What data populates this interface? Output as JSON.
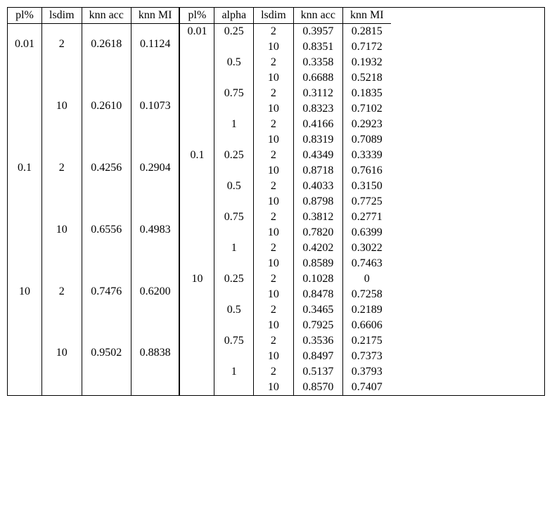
{
  "chart_data": {
    "type": "table",
    "title": "",
    "left_table": {
      "headers": [
        "pl%",
        "lsdim",
        "knn acc",
        "knn MI"
      ],
      "rows": [
        {
          "pl": "0.01",
          "lsdim": "2",
          "acc": "0.2618",
          "mi": "0.1124",
          "bold": true
        },
        {
          "pl": "",
          "lsdim": "",
          "acc": "",
          "mi": ""
        },
        {
          "pl": "",
          "lsdim": "",
          "acc": "",
          "mi": ""
        },
        {
          "pl": "",
          "lsdim": "",
          "acc": "",
          "mi": ""
        },
        {
          "pl": "",
          "lsdim": "10",
          "acc": "0.2610",
          "mi": "0.1073"
        },
        {
          "pl": "",
          "lsdim": "",
          "acc": "",
          "mi": ""
        },
        {
          "pl": "",
          "lsdim": "",
          "acc": "",
          "mi": ""
        },
        {
          "pl": "",
          "lsdim": "",
          "acc": "",
          "mi": ""
        },
        {
          "pl": "0.1",
          "lsdim": "2",
          "acc": "0.4256",
          "mi": "0.2904"
        },
        {
          "pl": "",
          "lsdim": "",
          "acc": "",
          "mi": ""
        },
        {
          "pl": "",
          "lsdim": "",
          "acc": "",
          "mi": ""
        },
        {
          "pl": "",
          "lsdim": "",
          "acc": "",
          "mi": ""
        },
        {
          "pl": "",
          "lsdim": "10",
          "acc": "0.6556",
          "mi": "0.4983",
          "bold": true
        },
        {
          "pl": "",
          "lsdim": "",
          "acc": "",
          "mi": ""
        },
        {
          "pl": "",
          "lsdim": "",
          "acc": "",
          "mi": ""
        },
        {
          "pl": "",
          "lsdim": "",
          "acc": "",
          "mi": ""
        },
        {
          "pl": "10",
          "lsdim": "2",
          "acc": "0.7476",
          "mi": "0.6200"
        },
        {
          "pl": "",
          "lsdim": "",
          "acc": "",
          "mi": ""
        },
        {
          "pl": "",
          "lsdim": "",
          "acc": "",
          "mi": ""
        },
        {
          "pl": "",
          "lsdim": "",
          "acc": "",
          "mi": ""
        },
        {
          "pl": "",
          "lsdim": "10",
          "acc": "0.9502",
          "mi": "0.8838",
          "bold": true
        },
        {
          "pl": "",
          "lsdim": "",
          "acc": "",
          "mi": ""
        },
        {
          "pl": "",
          "lsdim": "",
          "acc": "",
          "mi": ""
        },
        {
          "pl": "",
          "lsdim": "",
          "acc": "",
          "mi": ""
        }
      ]
    },
    "right_table": {
      "headers": [
        "pl%",
        "alpha",
        "lsdim",
        "knn acc",
        "knn MI"
      ],
      "rows": [
        {
          "pl": "0.01",
          "alpha": "0.25",
          "lsdim": "2",
          "acc": "0.3957",
          "mi": "0.2815"
        },
        {
          "pl": "",
          "alpha": "",
          "lsdim": "10",
          "acc": "0.8351",
          "mi": "0.7172",
          "bold": true
        },
        {
          "pl": "",
          "alpha": "0.5",
          "lsdim": "2",
          "acc": "0.3358",
          "mi": "0.1932"
        },
        {
          "pl": "",
          "alpha": "",
          "lsdim": "10",
          "acc": "0.6688",
          "mi": "0.5218"
        },
        {
          "pl": "",
          "alpha": "0.75",
          "lsdim": "2",
          "acc": "0.3112",
          "mi": "0.1835"
        },
        {
          "pl": "",
          "alpha": "",
          "lsdim": "10",
          "acc": "0.8323",
          "mi": "0.7102"
        },
        {
          "pl": "",
          "alpha": "1",
          "lsdim": "2",
          "acc": "0.4166",
          "mi": "0.2923"
        },
        {
          "pl": "",
          "alpha": "",
          "lsdim": "10",
          "acc": "0.8319",
          "mi": "0.7089"
        },
        {
          "pl": "0.1",
          "alpha": "0.25",
          "lsdim": "2",
          "acc": "0.4349",
          "mi": "0.3339"
        },
        {
          "pl": "",
          "alpha": "",
          "lsdim": "10",
          "acc": "0.8718",
          "mi": "0.7616"
        },
        {
          "pl": "",
          "alpha": "0.5",
          "lsdim": "2",
          "acc": "0.4033",
          "mi": "0.3150"
        },
        {
          "pl": "",
          "alpha": "",
          "lsdim": "10",
          "acc": "0.8798",
          "mi": "0.7725",
          "bold": true
        },
        {
          "pl": "",
          "alpha": "0.75",
          "lsdim": "2",
          "acc": "0.3812",
          "mi": "0.2771"
        },
        {
          "pl": "",
          "alpha": "",
          "lsdim": "10",
          "acc": "0.7820",
          "mi": "0.6399"
        },
        {
          "pl": "",
          "alpha": "1",
          "lsdim": "2",
          "acc": "0.4202",
          "mi": "0.3022"
        },
        {
          "pl": "",
          "alpha": "",
          "lsdim": "10",
          "acc": "0.8589",
          "mi": "0.7463"
        },
        {
          "pl": "10",
          "alpha": "0.25",
          "lsdim": "2",
          "acc": "0.1028",
          "mi": "0"
        },
        {
          "pl": "",
          "alpha": "",
          "lsdim": "10",
          "acc": "0.8478",
          "mi": "0.7258"
        },
        {
          "pl": "",
          "alpha": "0.5",
          "lsdim": "2",
          "acc": "0.3465",
          "mi": "0.2189"
        },
        {
          "pl": "",
          "alpha": "",
          "lsdim": "10",
          "acc": "0.7925",
          "mi": "0.6606"
        },
        {
          "pl": "",
          "alpha": "0.75",
          "lsdim": "2",
          "acc": "0.3536",
          "mi": "0.2175"
        },
        {
          "pl": "",
          "alpha": "",
          "lsdim": "10",
          "acc": "0.8497",
          "mi": "0.7373"
        },
        {
          "pl": "",
          "alpha": "1",
          "lsdim": "2",
          "acc": "0.5137",
          "mi": "0.3793"
        },
        {
          "pl": "",
          "alpha": "",
          "lsdim": "10",
          "acc": "0.8570",
          "mi": "0.7407",
          "bold": true
        }
      ]
    }
  }
}
